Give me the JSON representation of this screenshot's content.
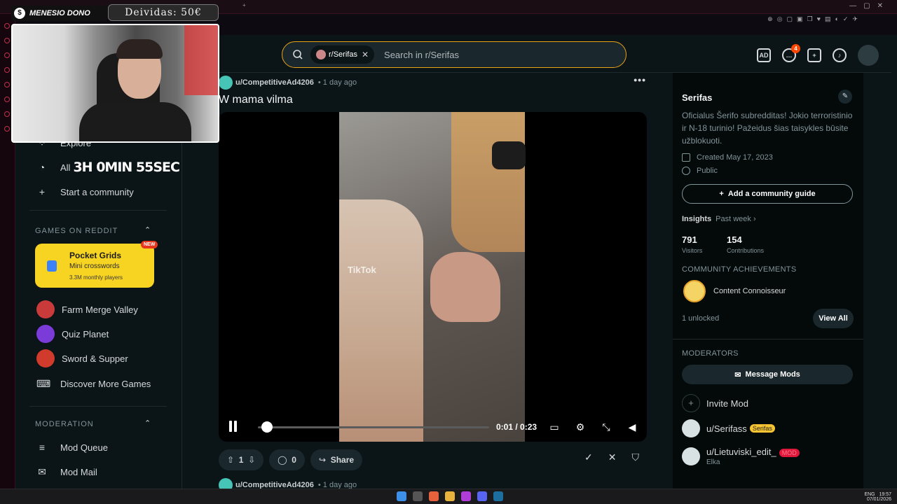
{
  "overlay": {
    "donation_label": "MENESIO DONO",
    "debt_label": "Deividas: 50€",
    "timer": "3H 0MIN 55SEC"
  },
  "header": {
    "search_chip": "r/Serifas",
    "search_placeholder": "Search in r/Serifas",
    "chat_badge": "4"
  },
  "sidebar": {
    "explore": "Explore",
    "all": "All",
    "start_community": "Start a community",
    "games_heading": "GAMES ON REDDIT",
    "pocket_grids": {
      "title": "Pocket Grids",
      "subtitle": "Mini crosswords",
      "players": "3.3M monthly players",
      "badge": "NEW"
    },
    "games": [
      "Farm Merge Valley",
      "Quiz Planet",
      "Sword & Supper",
      "Discover More Games"
    ],
    "moderation_heading": "MODERATION",
    "mod_items": [
      "Mod Queue",
      "Mod Mail"
    ]
  },
  "post": {
    "author": "u/CompetitiveAd4206",
    "time": "1 day ago",
    "title": "W mama vilma",
    "watermark": "TikTok",
    "video_time": "0:01 / 0:23",
    "progress": 0.04,
    "votes": "1",
    "comments": "0",
    "share": "Share"
  },
  "next_post": {
    "author": "u/CompetitiveAd4206",
    "time": "1 day ago"
  },
  "community": {
    "name": "Serifas",
    "description": "Oficialus Šerifo subredditas! Jokio terroristinio ir N-18 turinio! Pažeidus šias taisykles būsite užblokuoti.",
    "created": "Created May 17, 2023",
    "visibility": "Public",
    "guide_button": "Add a community guide",
    "insights": "Insights",
    "past_week": "Past week",
    "visitors": "791",
    "visitors_label": "Visitors",
    "contributions": "154",
    "contributions_label": "Contributions",
    "achievements_heading": "COMMUNITY ACHIEVEMENTS",
    "achievement": "Content Connoisseur",
    "unlocked": "1 unlocked",
    "view_all": "View All",
    "moderators_heading": "MODERATORS",
    "message_mods": "Message Mods",
    "invite_mod": "Invite Mod",
    "mods": [
      {
        "name": "u/Serifass",
        "flair": "Serifas"
      },
      {
        "name": "u/Lietuviski_edit_",
        "flair": "MOD",
        "sub": "Elka"
      }
    ]
  },
  "taskbar": {
    "lang": "ENG",
    "time": "19:57",
    "date": "07/01/2026"
  }
}
